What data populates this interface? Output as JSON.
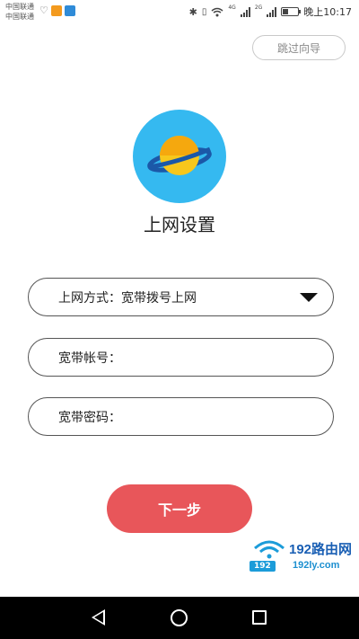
{
  "status_bar": {
    "carrier1": "中国联通",
    "carrier2": "中国联通",
    "network_badge1": "4G",
    "network_badge2": "2G",
    "battery_level": 0.35,
    "time": "晚上10:17"
  },
  "header": {
    "skip_label": "跳过向导"
  },
  "logo": {
    "icon": "planet-icon",
    "background_color": "#35b9f0"
  },
  "page_title": "上网设置",
  "form": {
    "connection_type": {
      "label": "上网方式：",
      "value": "宽带拨号上网"
    },
    "account": {
      "label": "宽带帐号：",
      "value": ""
    },
    "password": {
      "label": "宽带密码：",
      "value": ""
    }
  },
  "next_button": {
    "label": "下一步",
    "color": "#e8565a"
  },
  "watermark": {
    "brand": "192路由网",
    "badge": "192",
    "url": "192ly.com"
  },
  "nav_bar": {
    "back_icon": "back-triangle-icon",
    "home_icon": "home-circle-icon",
    "recent_icon": "recent-square-icon"
  }
}
